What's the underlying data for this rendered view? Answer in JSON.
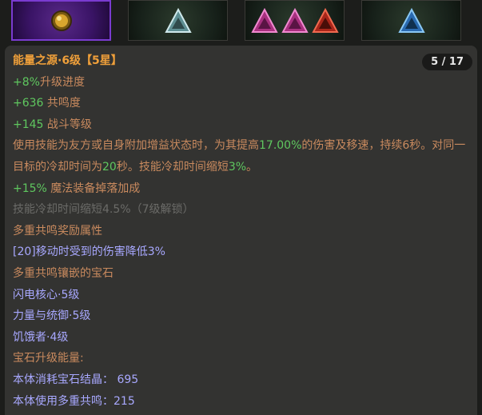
{
  "slots": [
    {
      "icon": "orb-gem-icon",
      "color": "#d9a62e",
      "selected": true
    },
    {
      "icon": "triangle-gem-icon",
      "color": "#9fd0d4"
    },
    {
      "icons": [
        "triangle-gem-icon",
        "triangle-gem-icon",
        "triangle-gem-icon"
      ],
      "colors": [
        "#d94fb0",
        "#d94fb0",
        "#d93a2a"
      ]
    },
    {
      "icon": "triangle-gem-icon",
      "color": "#3a8fe0"
    }
  ],
  "tooltip": {
    "title": "能量之源·6级",
    "stars": "【5星】",
    "page": "5 / 17",
    "stat1_val": "+8%",
    "stat1_label": "升级进度",
    "stat2_val": "+636",
    "stat2_label": " 共鸣度",
    "stat3_val": "+145",
    "stat3_label": " 战斗等级",
    "desc_a": "使用技能为友方或自身附加增益状态时，为其提高",
    "desc_pct": "17.00%",
    "desc_b": "的伤害及移速，持续6秒。对同一目标的冷却时间为",
    "desc_sec": "20",
    "desc_c": "秒。技能冷却时间缩短",
    "desc_cd": "3%",
    "desc_d": "。",
    "stat4_val": "+15%",
    "stat4_label": " 魔法装备掉落加成",
    "locked_line": "技能冷却时间缩短4.5%（7级解锁）",
    "resonance_header": "多重共鸣奖励属性",
    "resonance_bonus": "[20]移动时受到的伤害降低3%",
    "socketed_header": "多重共鸣镶嵌的宝石",
    "gem1": "闪电核心·5级",
    "gem2": "力量与统御·5级",
    "gem3": "饥饿者·4级",
    "energy_header": "宝石升级能量:",
    "consume_label": "本体消耗宝石结晶：",
    "consume_val": "695",
    "resonance_use_label": "本体使用多重共鸣：",
    "resonance_use_val": "215"
  }
}
